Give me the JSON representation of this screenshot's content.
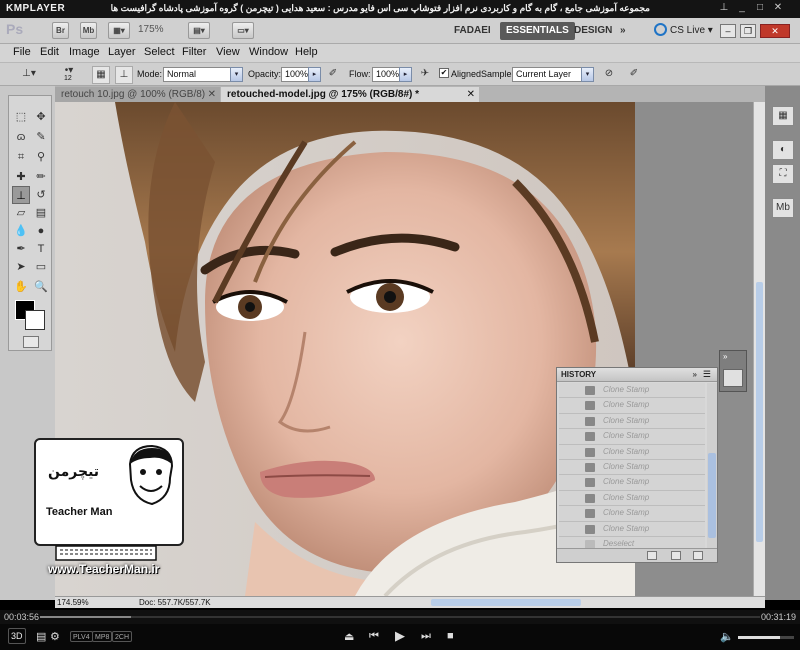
{
  "kmplayer": {
    "logo": "KMPLAYER",
    "caption": "مجموعه آموزشی جامع ، گام به گام و کاربردی نرم افزار فتوشاپ سی اس فایو   مدرس : سعید هدایی ( تیچرمن ) گروه آموزشی پادشاه گرافیست ها",
    "time_elapsed": "00:03:56",
    "time_total": "00:31:19",
    "progress": 0.126,
    "volume": 0.75,
    "chips": [
      "PLV4",
      "MP8",
      "2CH"
    ],
    "mode_3d": "3D"
  },
  "ps_appbar": {
    "logo": "Ps",
    "bridge": "Br",
    "minibridge": "Mb",
    "zoom": "175%",
    "workspaces": [
      "FADAEI",
      "ESSENTIALS",
      "DESIGN"
    ],
    "active_workspace": "ESSENTIALS",
    "more": "»",
    "cs_live": "CS Live"
  },
  "menu": [
    "File",
    "Edit",
    "Image",
    "Layer",
    "Select",
    "Filter",
    "View",
    "Window",
    "Help"
  ],
  "options": {
    "brush_size": "12",
    "mode_label": "Mode:",
    "mode_value": "Normal",
    "opacity_label": "Opacity:",
    "opacity_value": "100%",
    "flow_label": "Flow:",
    "flow_value": "100%",
    "aligned_label": "Aligned",
    "aligned_checked": true,
    "sample_label": "Sample:",
    "sample_value": "Current Layer"
  },
  "documents": {
    "tabs": [
      {
        "label": "retouch 10.jpg @ 100% (RGB/8)"
      },
      {
        "label": "retouched-model.jpg @ 175% (RGB/8#) *"
      }
    ],
    "active_tab": 1
  },
  "status": {
    "zoom": "174.59%",
    "doc_size": "Doc: 557.7K/557.7K"
  },
  "history": {
    "title": "HISTORY",
    "items": [
      "Clone Stamp",
      "Clone Stamp",
      "Clone Stamp",
      "Clone Stamp",
      "Clone Stamp",
      "Clone Stamp",
      "Clone Stamp",
      "Clone Stamp",
      "Clone Stamp",
      "Clone Stamp",
      "Deselect"
    ]
  },
  "watermark": {
    "brand_fa": "تیچرمن",
    "brand_en": "Teacher Man",
    "url": "www.TeacherMan.ir"
  }
}
